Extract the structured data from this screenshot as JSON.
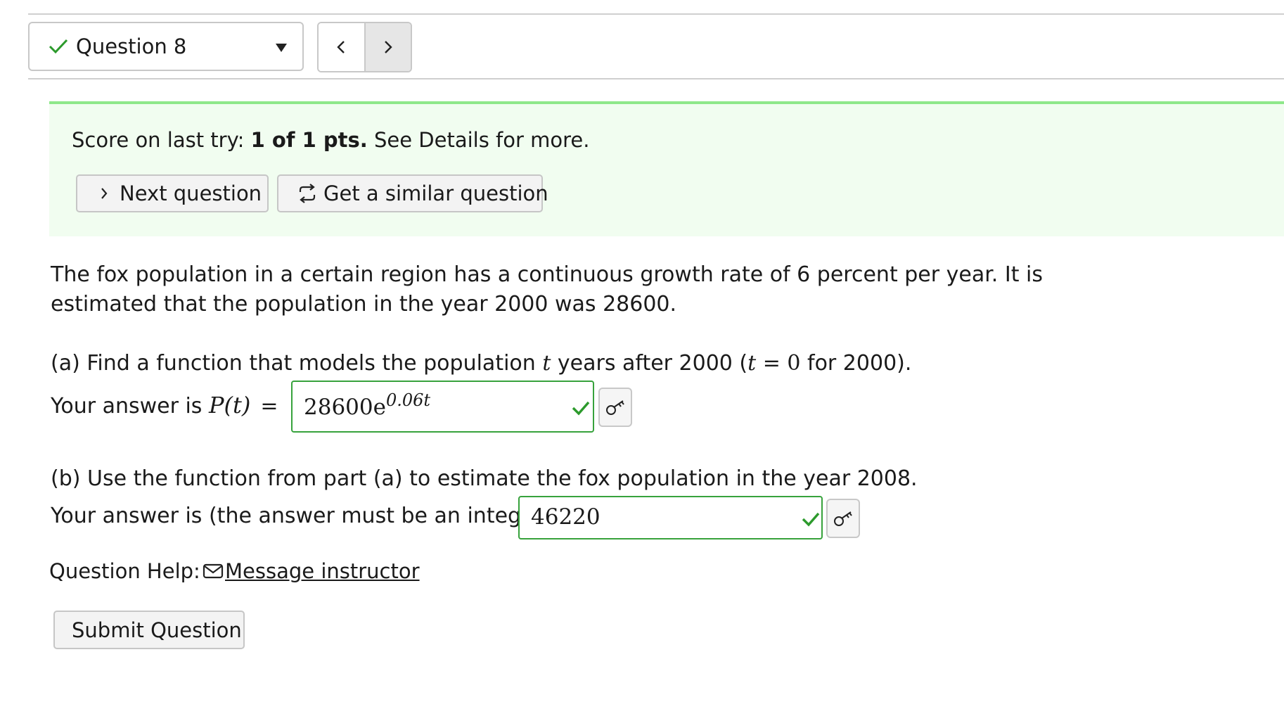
{
  "header": {
    "question_selector": {
      "label": "Question 8",
      "status_icon": "checkmark-icon"
    },
    "nav": {
      "prev_icon": "chevron-left-icon",
      "next_icon": "chevron-right-icon"
    }
  },
  "score": {
    "prefix": "Score on last try: ",
    "points": "1 of 1 pts.",
    "suffix": " See Details for more.",
    "next_button": "Next question",
    "similar_button": "Get a similar question"
  },
  "question": {
    "intro_line1": "The fox population in a certain region has a continuous growth rate of 6 percent per year. It is",
    "intro_line2": "estimated that the population in the year 2000 was 28600.",
    "part_a": {
      "prompt_start": "(a) Find a function that models the population ",
      "var": "t",
      "prompt_mid": " years after 2000 (",
      "condition_var": "t",
      "condition_eq": " = 0",
      "prompt_end": " for 2000).",
      "answer_label": "Your answer is ",
      "function_lhs": "P(t)",
      "equals": "=",
      "answer_base": "28600e",
      "answer_exponent": "0.06t"
    },
    "part_b": {
      "prompt": "(b) Use the function from part (a) to estimate the fox population in the year 2008.",
      "answer_label": "Your answer is (the answer must be an integer)",
      "answer_value": "46220"
    }
  },
  "help": {
    "label": "Question Help:",
    "message_link": "Message instructor"
  },
  "submit_button": "Submit Question",
  "colors": {
    "correct": "#37a23c",
    "score_bg": "#f1fdf0",
    "score_border": "#8ee88a"
  }
}
